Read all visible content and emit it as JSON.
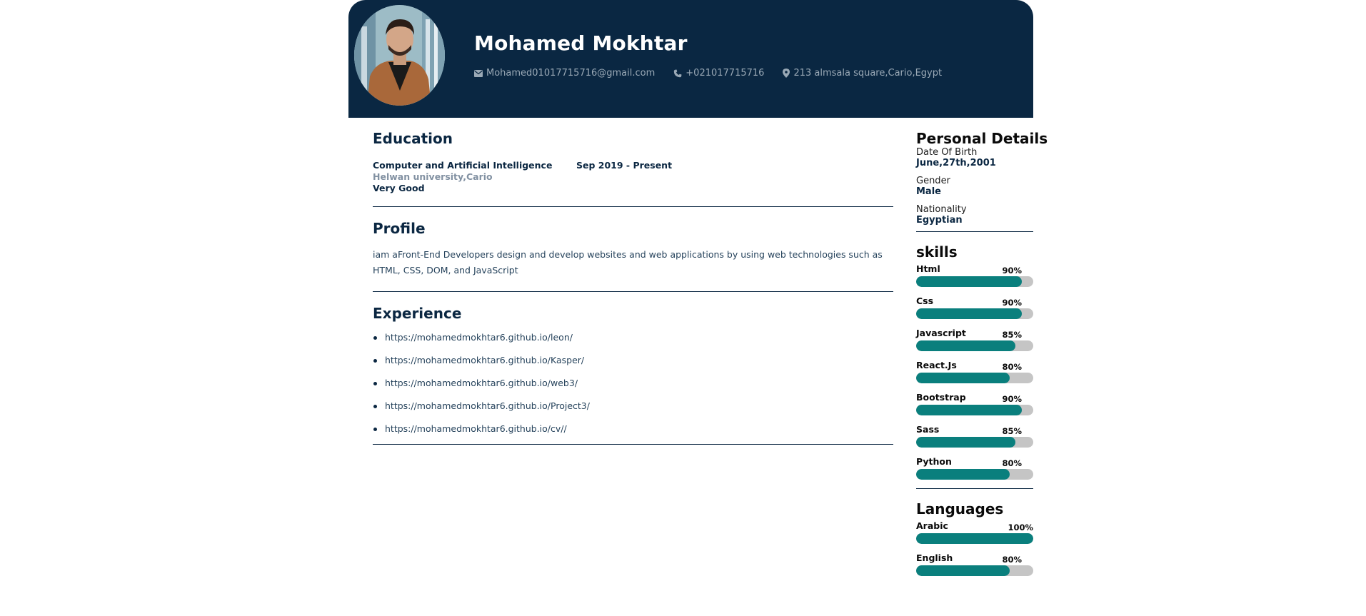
{
  "header": {
    "name": "Mohamed Mokhtar",
    "email": "Mohamed01017715716@gmail.com",
    "phone": "+021017715716",
    "address": "213 almsala square,Cario,Egypt",
    "icons": [
      "envelope-icon",
      "phone-icon",
      "map-pin-icon"
    ]
  },
  "education": {
    "title": "Education",
    "degree": "Computer and Artificial Intelligence",
    "date": "Sep 2019 - Present",
    "school": "Helwan university,Cario",
    "grade": "Very Good"
  },
  "profile": {
    "title": "Profile",
    "text": "iam aFront-End Developers design and develop websites and web applications by using web technologies such as HTML, CSS, DOM, and JavaScript"
  },
  "experience": {
    "title": "Experience",
    "links": [
      "https://mohamedmokhtar6.github.io/leon/",
      "https://mohamedmokhtar6.github.io/Kasper/",
      "https://mohamedmokhtar6.github.io/web3/",
      "https://mohamedmokhtar6.github.io/Project3/",
      "https://mohamedmokhtar6.github.io/cv//"
    ]
  },
  "personal": {
    "title": "Personal Details",
    "dob_label": "Date Of Birth",
    "dob": "June,27th,2001",
    "gender_label": "Gender",
    "gender": "Male",
    "nationality_label": "Nationality",
    "nationality": "Egyptian"
  },
  "skills": {
    "title": "skills",
    "items": [
      {
        "name": "Html",
        "percent": "90%",
        "value": 90
      },
      {
        "name": "Css",
        "percent": "90%",
        "value": 90
      },
      {
        "name": "Javascript",
        "percent": "85%",
        "value": 85
      },
      {
        "name": "React.Js",
        "percent": "80%",
        "value": 80
      },
      {
        "name": "Bootstrap",
        "percent": "90%",
        "value": 90
      },
      {
        "name": "Sass",
        "percent": "85%",
        "value": 85
      },
      {
        "name": "Python",
        "percent": "80%",
        "value": 80
      }
    ]
  },
  "languages": {
    "title": "Languages",
    "items": [
      {
        "name": "Arabic",
        "percent": "100%",
        "value": 100
      },
      {
        "name": "English",
        "percent": "80%",
        "value": 80
      }
    ]
  },
  "colors": {
    "header_bg": "#0a2742",
    "bar_fill": "#0a7f7d",
    "bar_track": "#c5c5c5"
  }
}
